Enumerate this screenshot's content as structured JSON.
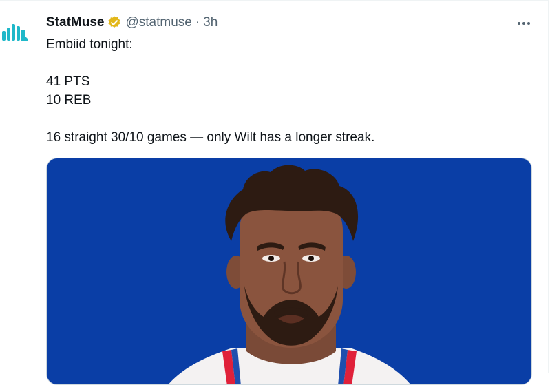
{
  "tweet": {
    "display_name": "StatMuse",
    "handle": "@statmuse",
    "separator": "·",
    "time": "3h",
    "lines": [
      "Embiid tonight:",
      "",
      "41 PTS",
      "10 REB",
      "",
      "16 straight 30/10 games — only Wilt has a longer streak."
    ]
  },
  "icons": {
    "avatar": "statmuse-logo-icon",
    "verified": "verified-badge-icon",
    "more": "more-options-icon"
  },
  "colors": {
    "media_background": "#0a3ea6",
    "verified_gold": "#e2b719",
    "logo_teal": "#1fb8c9",
    "secondary_text": "#536471"
  }
}
